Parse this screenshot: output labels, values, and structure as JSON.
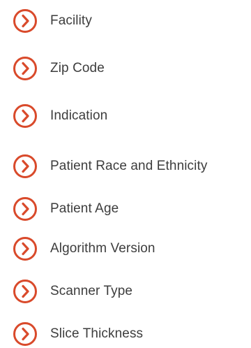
{
  "accent_color": "#d94a2b",
  "text_color": "#3d3d3d",
  "icon": "chevron-right-circle-icon",
  "filters": [
    {
      "label": "Facility"
    },
    {
      "label": "Zip Code"
    },
    {
      "label": "Indication"
    },
    {
      "label": "Patient Race and Ethnicity"
    },
    {
      "label": "Patient Age"
    },
    {
      "label": "Algorithm Version"
    },
    {
      "label": "Scanner Type"
    },
    {
      "label": "Slice Thickness"
    }
  ]
}
